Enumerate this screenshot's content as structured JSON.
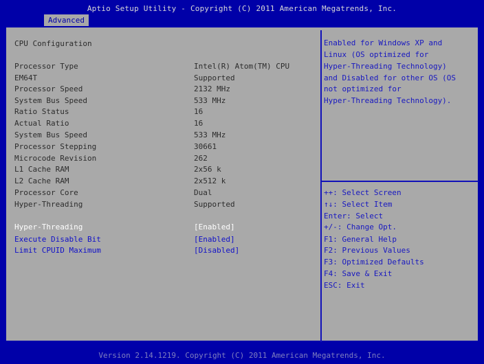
{
  "header": {
    "title": "Aptio Setup Utility - Copyright (C) 2011 American Megatrends, Inc.",
    "tab": "Advanced"
  },
  "section_title": "CPU Configuration",
  "info": [
    {
      "label": "Processor Type",
      "value": "Intel(R) Atom(TM) CPU"
    },
    {
      "label": "EM64T",
      "value": "Supported"
    },
    {
      "label": "Processor Speed",
      "value": "2132 MHz"
    },
    {
      "label": "System Bus Speed",
      "value": "533 MHz"
    },
    {
      "label": "Ratio Status",
      "value": "16"
    },
    {
      "label": "Actual Ratio",
      "value": "16"
    },
    {
      "label": "System Bus Speed",
      "value": "533 MHz"
    },
    {
      "label": "Processor Stepping",
      "value": "30661"
    },
    {
      "label": "Microcode Revision",
      "value": "262"
    },
    {
      "label": "L1 Cache RAM",
      "value": "2x56 k"
    },
    {
      "label": "L2 Cache RAM",
      "value": "2x512 k"
    },
    {
      "label": "Processor Core",
      "value": "Dual"
    },
    {
      "label": "Hyper-Threading",
      "value": "Supported"
    }
  ],
  "options": [
    {
      "label": "Hyper-Threading",
      "value": "[Enabled]"
    },
    {
      "label": "Execute Disable Bit",
      "value": "[Enabled]"
    },
    {
      "label": "Limit CPUID Maximum",
      "value": "[Disabled]"
    }
  ],
  "help_text": [
    "Enabled for Windows XP and",
    "Linux (OS optimized for",
    "Hyper-Threading Technology)",
    "and Disabled for other OS (OS",
    "not optimized for",
    "Hyper-Threading Technology)."
  ],
  "keys": [
    "++: Select Screen",
    "↑↓: Select Item",
    "Enter: Select",
    "+/-: Change Opt.",
    "F1: General Help",
    "F2: Previous Values",
    "F3: Optimized Defaults",
    "F4: Save & Exit",
    "ESC: Exit"
  ],
  "footer": "Version 2.14.1219. Copyright (C) 2011 American Megatrends, Inc."
}
